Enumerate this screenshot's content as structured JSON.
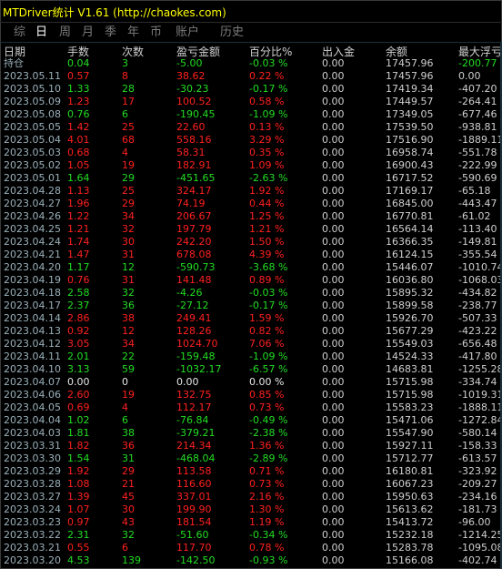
{
  "title": "MTDriver统计 V1.61  (http://chaokes.com)",
  "tabs": [
    {
      "label": "综",
      "active": false
    },
    {
      "label": "日",
      "active": true
    },
    {
      "label": "周",
      "active": false
    },
    {
      "label": "月",
      "active": false
    },
    {
      "label": "季",
      "active": false
    },
    {
      "label": "年",
      "active": false
    },
    {
      "label": "币",
      "active": false
    },
    {
      "label": "账户",
      "active": false
    },
    {
      "label": "历史",
      "active": false
    }
  ],
  "columns": [
    "日期",
    "手数",
    "次数",
    "盈亏金额",
    "百分比%",
    "出入金",
    "余额",
    "最大浮亏"
  ],
  "rows": [
    [
      "持仓",
      "0.04",
      "3",
      "-5.00",
      "-0.03 %",
      "0.00",
      "17457.96",
      "-200.77"
    ],
    [
      "2023.05.11",
      "0.57",
      "8",
      "38.62",
      "0.22 %",
      "0.00",
      "17457.96",
      "0.00"
    ],
    [
      "2023.05.10",
      "1.33",
      "28",
      "-30.23",
      "-0.17 %",
      "0.00",
      "17419.34",
      "-407.20"
    ],
    [
      "2023.05.09",
      "1.23",
      "17",
      "100.52",
      "0.58 %",
      "0.00",
      "17449.57",
      "-264.41"
    ],
    [
      "2023.05.08",
      "0.76",
      "6",
      "-190.45",
      "-1.09 %",
      "0.00",
      "17349.05",
      "-677.46"
    ],
    [
      "2023.05.05",
      "1.42",
      "25",
      "22.60",
      "0.13 %",
      "0.00",
      "17539.50",
      "-938.81"
    ],
    [
      "2023.05.04",
      "4.01",
      "68",
      "558.16",
      "3.29 %",
      "0.00",
      "17516.90",
      "-1889.11"
    ],
    [
      "2023.05.03",
      "0.68",
      "4",
      "58.31",
      "0.35 %",
      "0.00",
      "16958.74",
      "-551.78"
    ],
    [
      "2023.05.02",
      "1.05",
      "19",
      "182.91",
      "1.09 %",
      "0.00",
      "16900.43",
      "-222.99"
    ],
    [
      "2023.05.01",
      "1.64",
      "29",
      "-451.65",
      "-2.63 %",
      "0.00",
      "16717.52",
      "-590.69"
    ],
    [
      "2023.04.28",
      "1.13",
      "25",
      "324.17",
      "1.92 %",
      "0.00",
      "17169.17",
      "-65.18"
    ],
    [
      "2023.04.27",
      "1.96",
      "29",
      "74.19",
      "0.44 %",
      "0.00",
      "16845.00",
      "-443.47"
    ],
    [
      "2023.04.26",
      "1.22",
      "34",
      "206.67",
      "1.25 %",
      "0.00",
      "16770.81",
      "-61.02"
    ],
    [
      "2023.04.25",
      "1.21",
      "32",
      "197.79",
      "1.21 %",
      "0.00",
      "16564.14",
      "-113.40"
    ],
    [
      "2023.04.24",
      "1.74",
      "30",
      "242.20",
      "1.50 %",
      "0.00",
      "16366.35",
      "-149.81"
    ],
    [
      "2023.04.21",
      "1.47",
      "31",
      "678.08",
      "4.39 %",
      "0.00",
      "16124.15",
      "-355.54"
    ],
    [
      "2023.04.20",
      "1.17",
      "12",
      "-590.73",
      "-3.68 %",
      "0.00",
      "15446.07",
      "-1010.74"
    ],
    [
      "2023.04.19",
      "0.76",
      "31",
      "141.48",
      "0.89 %",
      "0.00",
      "16036.80",
      "-1068.03"
    ],
    [
      "2023.04.18",
      "2.58",
      "32",
      "-4.26",
      "-0.03 %",
      "0.00",
      "15895.32",
      "-434.82"
    ],
    [
      "2023.04.17",
      "2.37",
      "36",
      "-27.12",
      "-0.17 %",
      "0.00",
      "15899.58",
      "-238.77"
    ],
    [
      "2023.04.14",
      "2.86",
      "38",
      "249.41",
      "1.59 %",
      "0.00",
      "15926.70",
      "-507.33"
    ],
    [
      "2023.04.13",
      "0.92",
      "12",
      "128.26",
      "0.82 %",
      "0.00",
      "15677.29",
      "-423.22"
    ],
    [
      "2023.04.12",
      "3.05",
      "34",
      "1024.70",
      "7.06 %",
      "0.00",
      "15549.03",
      "-656.48"
    ],
    [
      "2023.04.11",
      "2.01",
      "22",
      "-159.48",
      "-1.09 %",
      "0.00",
      "14524.33",
      "-417.80"
    ],
    [
      "2023.04.10",
      "3.13",
      "59",
      "-1032.17",
      "-6.57 %",
      "0.00",
      "14683.81",
      "-1255.28"
    ],
    [
      "2023.04.07",
      "0.00",
      "0",
      "0.00",
      "0.00 %",
      "0.00",
      "15715.98",
      "-334.74"
    ],
    [
      "2023.04.06",
      "2.60",
      "19",
      "132.75",
      "0.85 %",
      "0.00",
      "15715.98",
      "-1019.31"
    ],
    [
      "2023.04.05",
      "0.69",
      "4",
      "112.17",
      "0.73 %",
      "0.00",
      "15583.23",
      "-1888.11"
    ],
    [
      "2023.04.04",
      "1.02",
      "6",
      "-76.84",
      "-0.49 %",
      "0.00",
      "15471.06",
      "-1272.84"
    ],
    [
      "2023.04.03",
      "1.81",
      "38",
      "-379.21",
      "-2.38 %",
      "0.00",
      "15547.90",
      "-580.14"
    ],
    [
      "2023.03.31",
      "1.82",
      "36",
      "214.34",
      "1.36 %",
      "0.00",
      "15927.11",
      "-158.33"
    ],
    [
      "2023.03.30",
      "1.54",
      "31",
      "-468.04",
      "-2.89 %",
      "0.00",
      "15712.77",
      "-613.57"
    ],
    [
      "2023.03.29",
      "1.92",
      "29",
      "113.58",
      "0.71 %",
      "0.00",
      "16180.81",
      "-323.92"
    ],
    [
      "2023.03.28",
      "1.08",
      "21",
      "116.60",
      "0.73 %",
      "0.00",
      "16067.23",
      "-209.27"
    ],
    [
      "2023.03.27",
      "1.39",
      "45",
      "337.01",
      "2.16 %",
      "0.00",
      "15950.63",
      "-234.16"
    ],
    [
      "2023.03.24",
      "1.07",
      "30",
      "199.90",
      "1.30 %",
      "0.00",
      "15613.62",
      "-181.73"
    ],
    [
      "2023.03.23",
      "0.97",
      "43",
      "181.54",
      "1.19 %",
      "0.00",
      "15413.72",
      "-96.00"
    ],
    [
      "2023.03.22",
      "2.31",
      "32",
      "-51.60",
      "-0.34 %",
      "0.00",
      "15232.18",
      "-1214.25"
    ],
    [
      "2023.03.21",
      "0.55",
      "6",
      "117.70",
      "0.78 %",
      "0.00",
      "15283.78",
      "-1095.08"
    ],
    [
      "2023.03.20",
      "4.53",
      "139",
      "-142.50",
      "-0.93 %",
      "0.00",
      "15166.08",
      "-402.74"
    ]
  ],
  "colors": {
    "background": "#000000",
    "title": "#ffff00",
    "positive": "#22dd22",
    "negative": "#ff2020",
    "zero": "#e8e8e8",
    "header": "#d0d0d0",
    "tab_inactive": "#7a7a7a",
    "tab_active": "#ffffff"
  }
}
